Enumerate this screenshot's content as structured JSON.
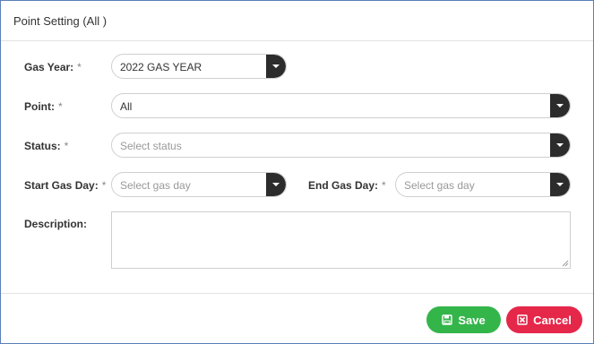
{
  "dialog": {
    "title": "Point Setting (All )"
  },
  "form": {
    "gas_year": {
      "label": "Gas Year:",
      "required": "*",
      "value": "2022 GAS YEAR"
    },
    "point": {
      "label": "Point:",
      "required": "*",
      "value": "All"
    },
    "status": {
      "label": "Status:",
      "required": "*",
      "placeholder": "Select status"
    },
    "start_gas_day": {
      "label": "Start Gas Day:",
      "required": "*",
      "placeholder": "Select gas day"
    },
    "end_gas_day": {
      "label": "End Gas Day:",
      "required": "*",
      "placeholder": "Select gas day"
    },
    "description": {
      "label": "Description:",
      "value": ""
    }
  },
  "actions": {
    "save_label": "Save",
    "cancel_label": "Cancel"
  },
  "colors": {
    "save": "#34b54a",
    "cancel": "#e5274a",
    "caret": "#2c2c2c",
    "border": "#5b7fb5"
  },
  "icons": {
    "caret": "chevron-down-icon",
    "save": "floppy-disk-icon",
    "cancel": "close-box-icon"
  }
}
